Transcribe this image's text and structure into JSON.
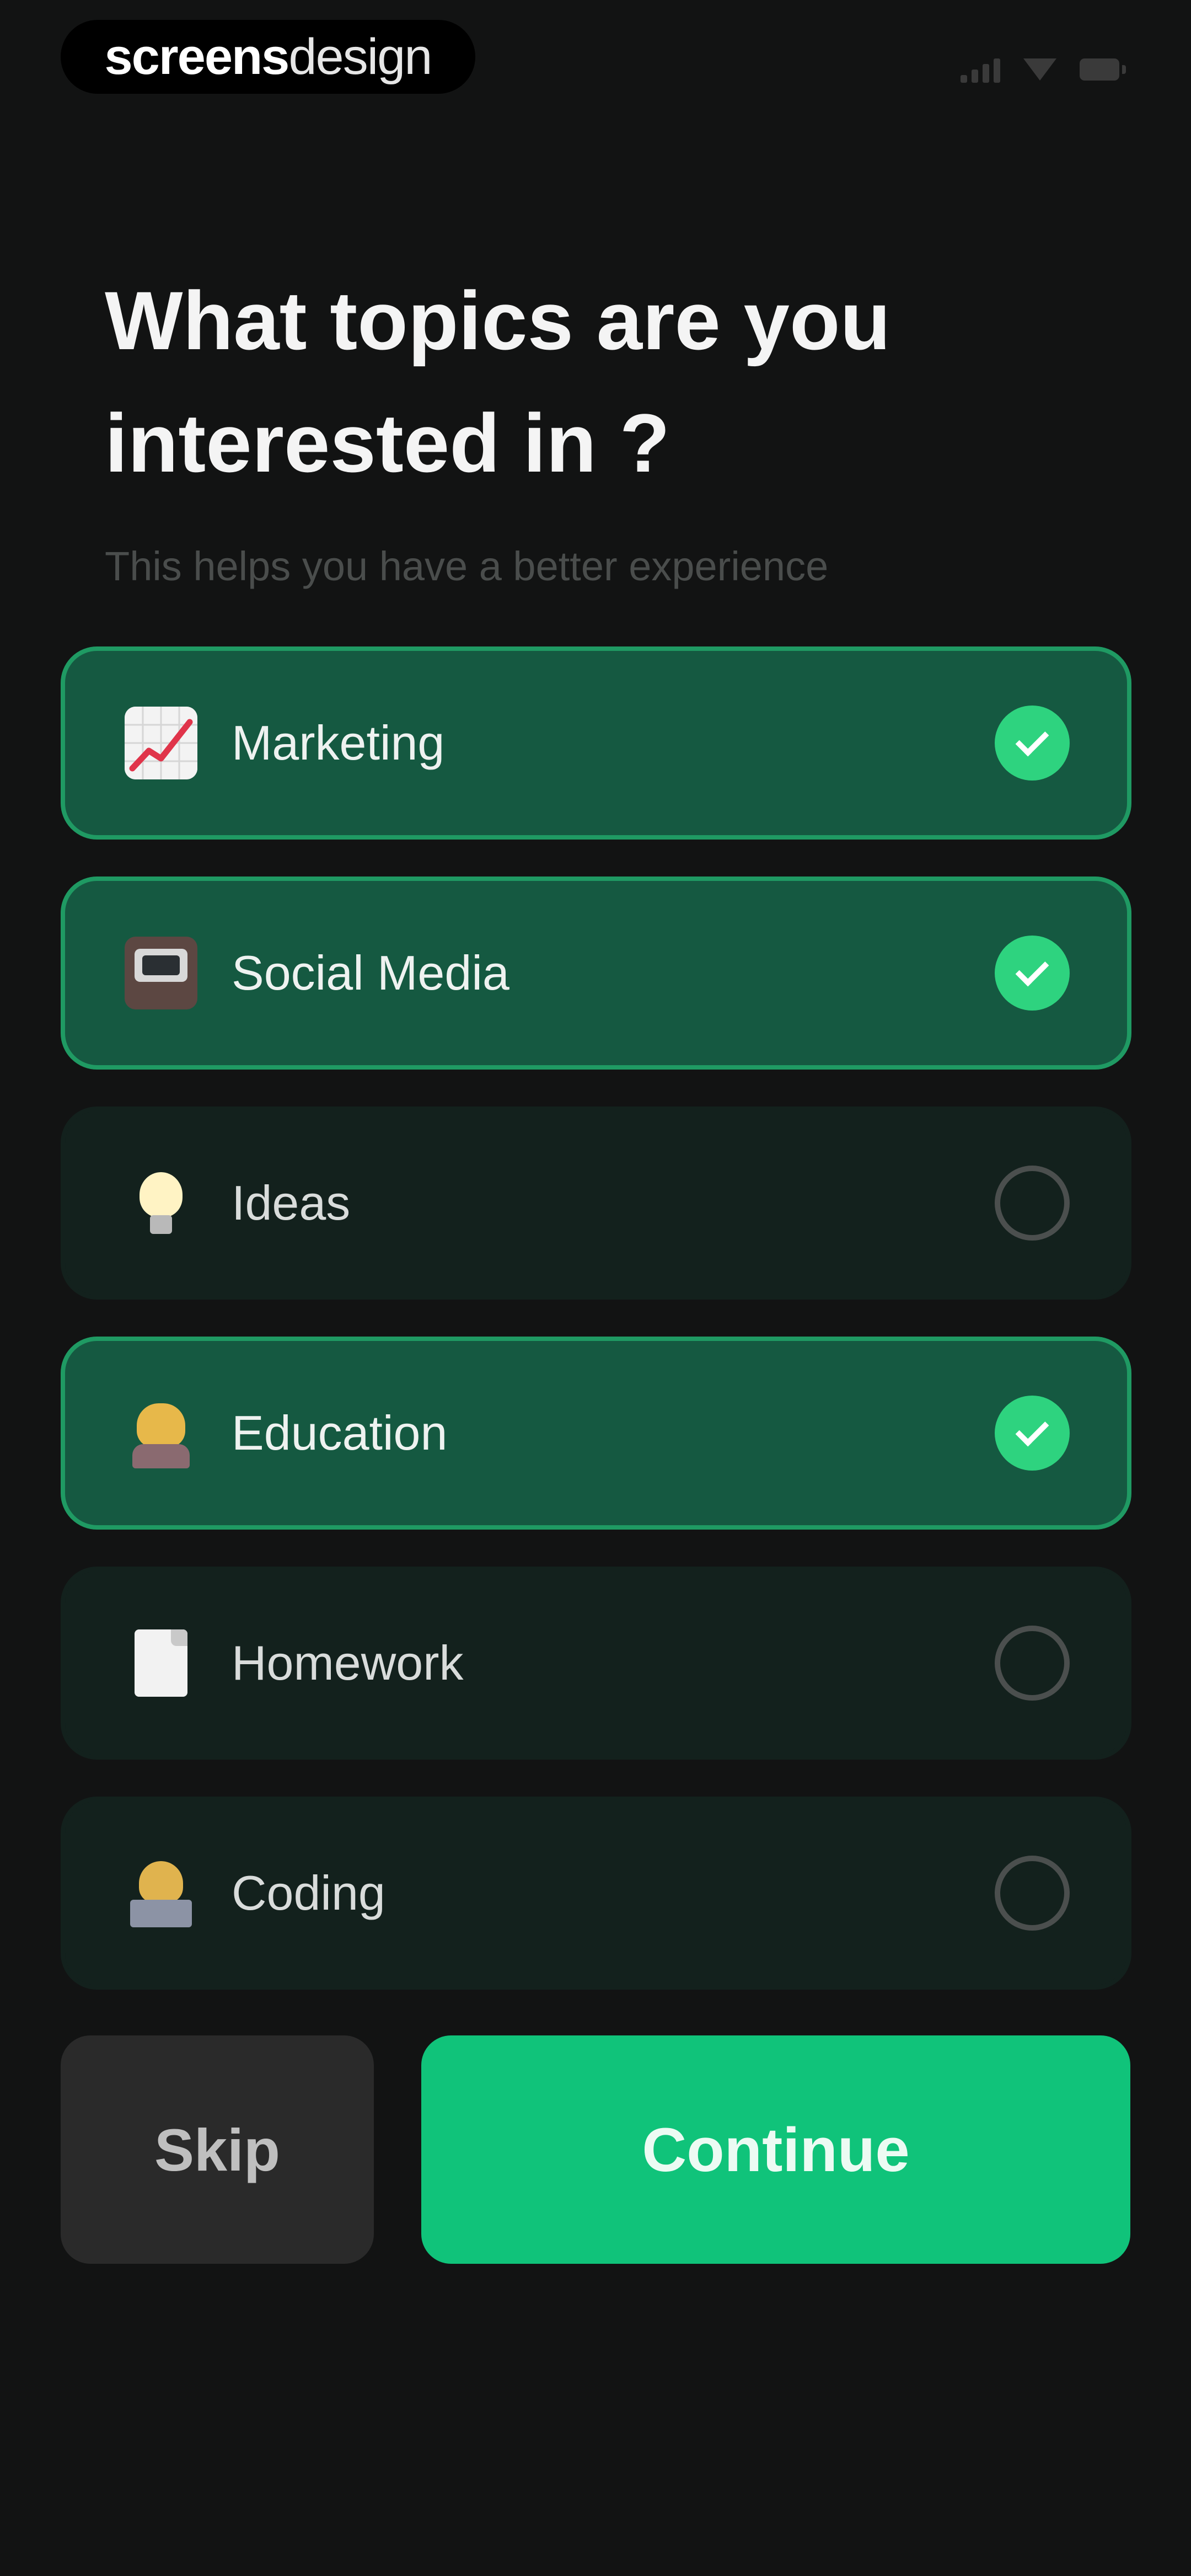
{
  "status_bar": {
    "brand_bold": "screens",
    "brand_light": "design"
  },
  "header": {
    "title": "What topics are you interested in ?",
    "subtitle": "This helps you have a better experience"
  },
  "topics": [
    {
      "label": "Marketing",
      "icon": "chart-increasing-icon",
      "selected": true
    },
    {
      "label": "Social Media",
      "icon": "laptop-icon",
      "selected": true
    },
    {
      "label": "Ideas",
      "icon": "light-bulb-icon",
      "selected": false
    },
    {
      "label": "Education",
      "icon": "teacher-icon",
      "selected": true
    },
    {
      "label": "Homework",
      "icon": "document-icon",
      "selected": false
    },
    {
      "label": "Coding",
      "icon": "technologist-icon",
      "selected": false
    }
  ],
  "actions": {
    "skip_label": "Skip",
    "continue_label": "Continue"
  },
  "colors": {
    "background": "#121313",
    "card_selected": "#155941",
    "card_selected_border": "#1f9a63",
    "card_unselected": "#13211d",
    "check_on": "#2ed37f",
    "continue_button": "#10c37a",
    "skip_button": "#2a2a2a"
  }
}
